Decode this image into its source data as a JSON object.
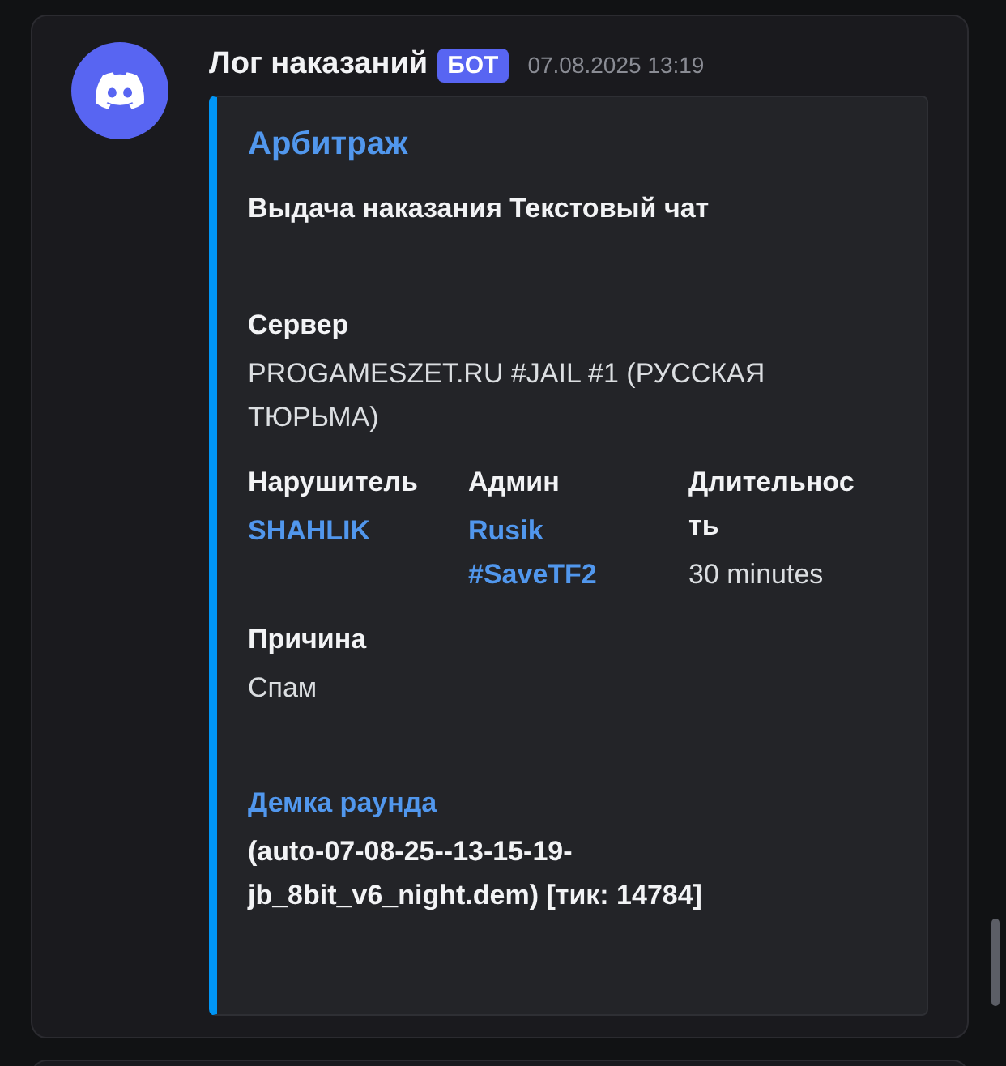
{
  "message": {
    "author": "Лог наказаний",
    "badge": "БОТ",
    "timestamp": "07.08.2025 13:19"
  },
  "embed": {
    "title": "Арбитраж",
    "description": "Выдача наказания Текстовый чат",
    "fields": [
      {
        "name": "Сервер",
        "value": "PROGAMESZET.RU #JAIL #1 (РУССКАЯ ТЮРЬМА)",
        "inline": false,
        "kind": "text"
      },
      {
        "name": "Нарушитель",
        "value": "SHAHLIK",
        "inline": true,
        "kind": "user"
      },
      {
        "name": "Админ",
        "value": "Rusik #SaveTF2",
        "inline": true,
        "kind": "user"
      },
      {
        "name": "Длительность",
        "value": "30 minutes",
        "inline": true,
        "kind": "text"
      },
      {
        "name": "Причина",
        "value": "Спам",
        "inline": false,
        "kind": "text"
      },
      {
        "name": "Демка раунда",
        "value": "(auto-07-08-25--13-15-19-jb_8bit_v6_night.dem) [тик: 14784]",
        "inline": false,
        "kind": "demo"
      }
    ]
  }
}
